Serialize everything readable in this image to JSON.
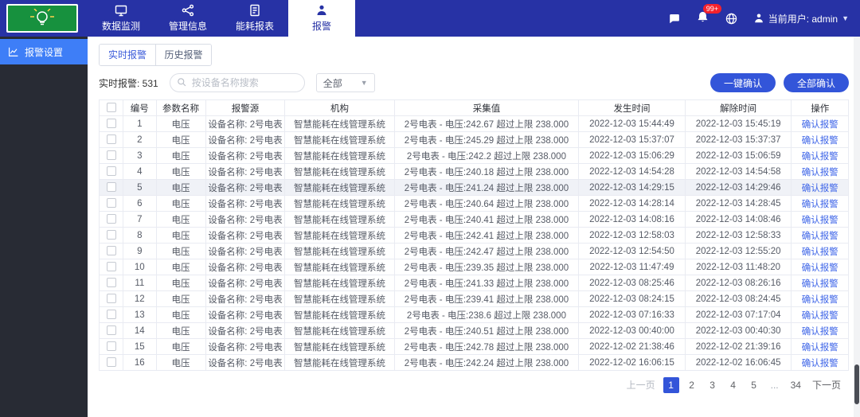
{
  "colors": {
    "navbar_bg": "#2732a5",
    "sidebar_bg": "#282b34",
    "sidebar_active": "#3e7ef7",
    "button_blue": "#3355d9",
    "link_blue": "#3f66e8",
    "badge_red": "#f5222d",
    "logo_green": "#17913e"
  },
  "navbar": {
    "items": [
      {
        "label": "数据监测",
        "icon": "monitor-icon",
        "active": false
      },
      {
        "label": "管理信息",
        "icon": "share-icon",
        "active": false
      },
      {
        "label": "能耗报表",
        "icon": "report-icon",
        "active": false
      },
      {
        "label": "报警",
        "icon": "person-info-icon",
        "active": true
      }
    ],
    "notification_badge": "99+",
    "user_label": "当前用户: admin"
  },
  "sidebar": {
    "items": [
      {
        "label": "报警设置",
        "icon": "chart-icon",
        "active": true
      }
    ]
  },
  "tabs": [
    {
      "label": "实时报警",
      "active": true
    },
    {
      "label": "历史报警",
      "active": false
    }
  ],
  "toolbar": {
    "count_label": "实时报警: 531",
    "search_placeholder": "按设备名称搜索",
    "filter_value": "全部",
    "confirm_selected_label": "一键确认",
    "confirm_all_label": "全部确认"
  },
  "table": {
    "headers": [
      "编号",
      "参数名称",
      "报警源",
      "机构",
      "采集值",
      "发生时间",
      "解除时间",
      "操作"
    ],
    "action_label": "确认报警",
    "rows": [
      {
        "id": "1",
        "param": "电压",
        "source": "设备名称: 2号电表",
        "org": "智慧能耗在线管理系统",
        "value": "2号电表 - 电压:242.67 超过上限 238.000",
        "occurred": "2022-12-03 15:44:49",
        "cleared": "2022-12-03 15:45:19",
        "highlight": false
      },
      {
        "id": "2",
        "param": "电压",
        "source": "设备名称: 2号电表",
        "org": "智慧能耗在线管理系统",
        "value": "2号电表 - 电压:245.29 超过上限 238.000",
        "occurred": "2022-12-03 15:37:07",
        "cleared": "2022-12-03 15:37:37",
        "highlight": false
      },
      {
        "id": "3",
        "param": "电压",
        "source": "设备名称: 2号电表",
        "org": "智慧能耗在线管理系统",
        "value": "2号电表 - 电压:242.2 超过上限 238.000",
        "occurred": "2022-12-03 15:06:29",
        "cleared": "2022-12-03 15:06:59",
        "highlight": false
      },
      {
        "id": "4",
        "param": "电压",
        "source": "设备名称: 2号电表",
        "org": "智慧能耗在线管理系统",
        "value": "2号电表 - 电压:240.18 超过上限 238.000",
        "occurred": "2022-12-03 14:54:28",
        "cleared": "2022-12-03 14:54:58",
        "highlight": false
      },
      {
        "id": "5",
        "param": "电压",
        "source": "设备名称: 2号电表",
        "org": "智慧能耗在线管理系统",
        "value": "2号电表 - 电压:241.24 超过上限 238.000",
        "occurred": "2022-12-03 14:29:15",
        "cleared": "2022-12-03 14:29:46",
        "highlight": true
      },
      {
        "id": "6",
        "param": "电压",
        "source": "设备名称: 2号电表",
        "org": "智慧能耗在线管理系统",
        "value": "2号电表 - 电压:240.64 超过上限 238.000",
        "occurred": "2022-12-03 14:28:14",
        "cleared": "2022-12-03 14:28:45",
        "highlight": false
      },
      {
        "id": "7",
        "param": "电压",
        "source": "设备名称: 2号电表",
        "org": "智慧能耗在线管理系统",
        "value": "2号电表 - 电压:240.41 超过上限 238.000",
        "occurred": "2022-12-03 14:08:16",
        "cleared": "2022-12-03 14:08:46",
        "highlight": false
      },
      {
        "id": "8",
        "param": "电压",
        "source": "设备名称: 2号电表",
        "org": "智慧能耗在线管理系统",
        "value": "2号电表 - 电压:242.41 超过上限 238.000",
        "occurred": "2022-12-03 12:58:03",
        "cleared": "2022-12-03 12:58:33",
        "highlight": false
      },
      {
        "id": "9",
        "param": "电压",
        "source": "设备名称: 2号电表",
        "org": "智慧能耗在线管理系统",
        "value": "2号电表 - 电压:242.47 超过上限 238.000",
        "occurred": "2022-12-03 12:54:50",
        "cleared": "2022-12-03 12:55:20",
        "highlight": false
      },
      {
        "id": "10",
        "param": "电压",
        "source": "设备名称: 2号电表",
        "org": "智慧能耗在线管理系统",
        "value": "2号电表 - 电压:239.35 超过上限 238.000",
        "occurred": "2022-12-03 11:47:49",
        "cleared": "2022-12-03 11:48:20",
        "highlight": false
      },
      {
        "id": "11",
        "param": "电压",
        "source": "设备名称: 2号电表",
        "org": "智慧能耗在线管理系统",
        "value": "2号电表 - 电压:241.33 超过上限 238.000",
        "occurred": "2022-12-03 08:25:46",
        "cleared": "2022-12-03 08:26:16",
        "highlight": false
      },
      {
        "id": "12",
        "param": "电压",
        "source": "设备名称: 2号电表",
        "org": "智慧能耗在线管理系统",
        "value": "2号电表 - 电压:239.41 超过上限 238.000",
        "occurred": "2022-12-03 08:24:15",
        "cleared": "2022-12-03 08:24:45",
        "highlight": false
      },
      {
        "id": "13",
        "param": "电压",
        "source": "设备名称: 2号电表",
        "org": "智慧能耗在线管理系统",
        "value": "2号电表 - 电压:238.6 超过上限 238.000",
        "occurred": "2022-12-03 07:16:33",
        "cleared": "2022-12-03 07:17:04",
        "highlight": false
      },
      {
        "id": "14",
        "param": "电压",
        "source": "设备名称: 2号电表",
        "org": "智慧能耗在线管理系统",
        "value": "2号电表 - 电压:240.51 超过上限 238.000",
        "occurred": "2022-12-03 00:40:00",
        "cleared": "2022-12-03 00:40:30",
        "highlight": false
      },
      {
        "id": "15",
        "param": "电压",
        "source": "设备名称: 2号电表",
        "org": "智慧能耗在线管理系统",
        "value": "2号电表 - 电压:242.78 超过上限 238.000",
        "occurred": "2022-12-02 21:38:46",
        "cleared": "2022-12-02 21:39:16",
        "highlight": false
      },
      {
        "id": "16",
        "param": "电压",
        "source": "设备名称: 2号电表",
        "org": "智慧能耗在线管理系统",
        "value": "2号电表 - 电压:242.24 超过上限 238.000",
        "occurred": "2022-12-02 16:06:15",
        "cleared": "2022-12-02 16:06:45",
        "highlight": false
      }
    ]
  },
  "pagination": {
    "prev_label": "上一页",
    "next_label": "下一页",
    "pages": [
      "1",
      "2",
      "3",
      "4",
      "5",
      "...",
      "34"
    ],
    "active_page": "1"
  }
}
